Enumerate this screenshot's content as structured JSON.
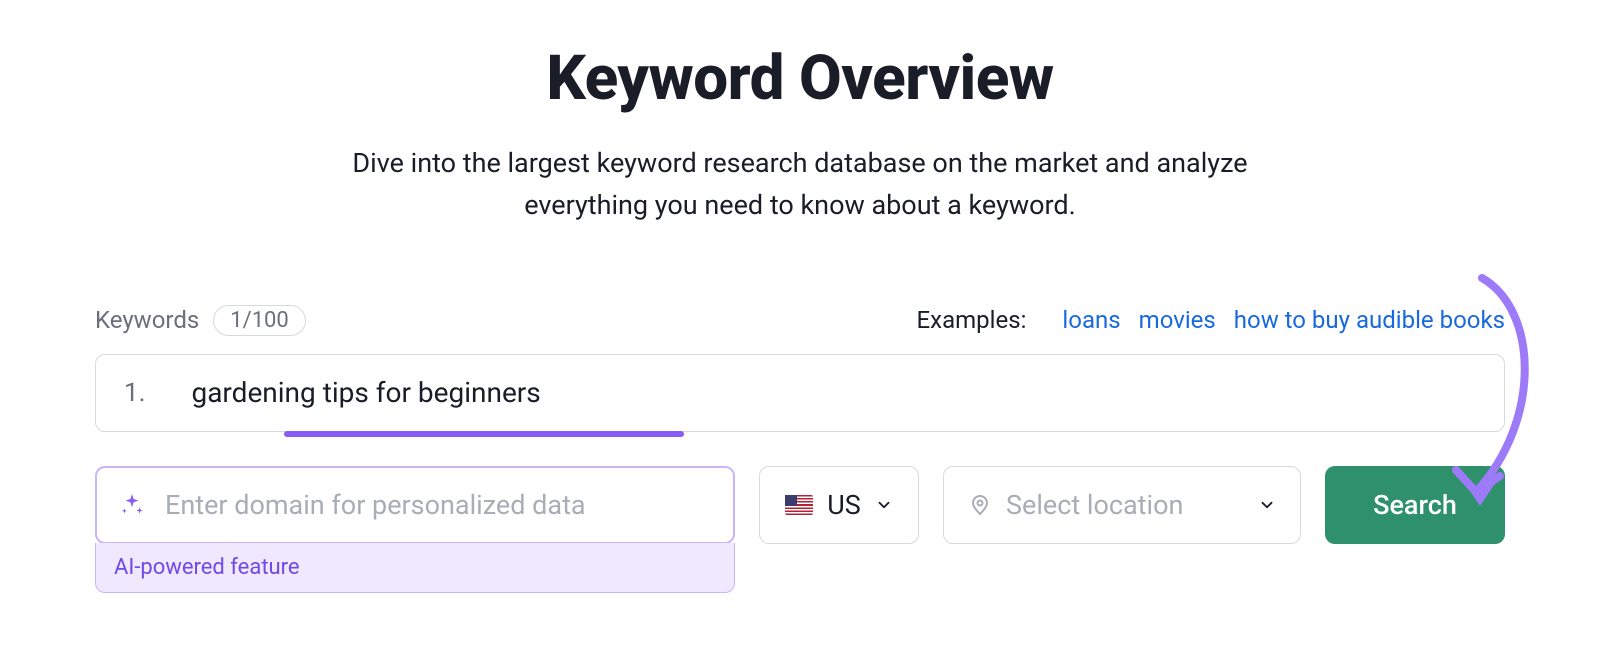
{
  "header": {
    "title": "Keyword Overview",
    "subtitle": "Dive into the largest keyword research database on the market and analyze everything you need to know about a keyword."
  },
  "keywords": {
    "label": "Keywords",
    "count": "1/100",
    "input_number": "1.",
    "input_value": "gardening tips for beginners"
  },
  "examples": {
    "label": "Examples:",
    "items": [
      "loans",
      "movies",
      "how to buy audible books"
    ]
  },
  "domain": {
    "placeholder": "Enter domain for personalized data",
    "caption": "AI-powered feature"
  },
  "database": {
    "value": "US"
  },
  "location": {
    "placeholder": "Select location"
  },
  "search": {
    "label": "Search"
  },
  "colors": {
    "accent_purple": "#8a5cf6",
    "accent_green": "#2f906c",
    "link": "#1769dd"
  }
}
